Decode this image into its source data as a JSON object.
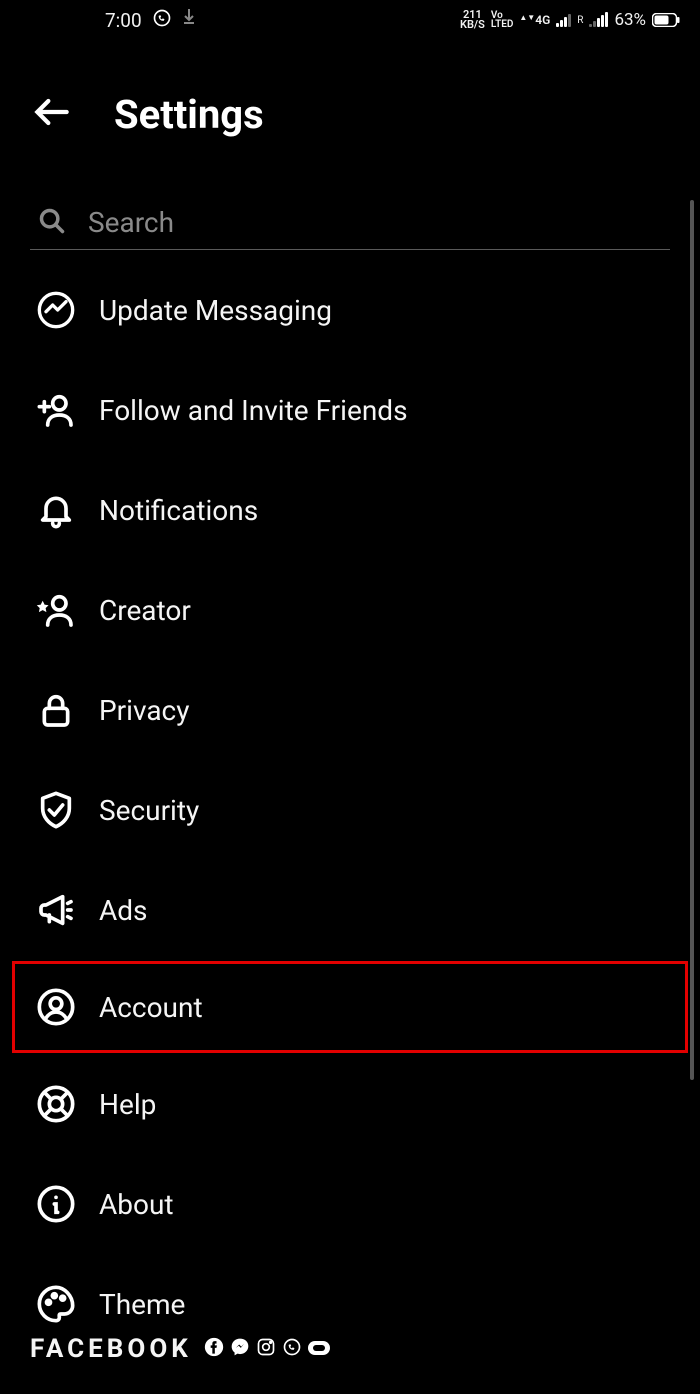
{
  "status": {
    "time": "7:00",
    "speed_value": "211",
    "speed_unit": "KB/S",
    "vo": "Vo",
    "lte": "LTED",
    "net": "4G",
    "roaming": "R",
    "battery": "63%"
  },
  "header": {
    "title": "Settings"
  },
  "search": {
    "placeholder": "Search"
  },
  "menu": {
    "items": [
      {
        "label": "Update Messaging",
        "icon": "messenger"
      },
      {
        "label": "Follow and Invite Friends",
        "icon": "person-add"
      },
      {
        "label": "Notifications",
        "icon": "bell"
      },
      {
        "label": "Creator",
        "icon": "star-person"
      },
      {
        "label": "Privacy",
        "icon": "lock"
      },
      {
        "label": "Security",
        "icon": "shield-check"
      },
      {
        "label": "Ads",
        "icon": "megaphone"
      },
      {
        "label": "Account",
        "icon": "user-circle",
        "highlighted": true
      },
      {
        "label": "Help",
        "icon": "lifebuoy"
      },
      {
        "label": "About",
        "icon": "info"
      },
      {
        "label": "Theme",
        "icon": "palette"
      }
    ]
  },
  "footer": {
    "brand": "FACEBOOK"
  }
}
